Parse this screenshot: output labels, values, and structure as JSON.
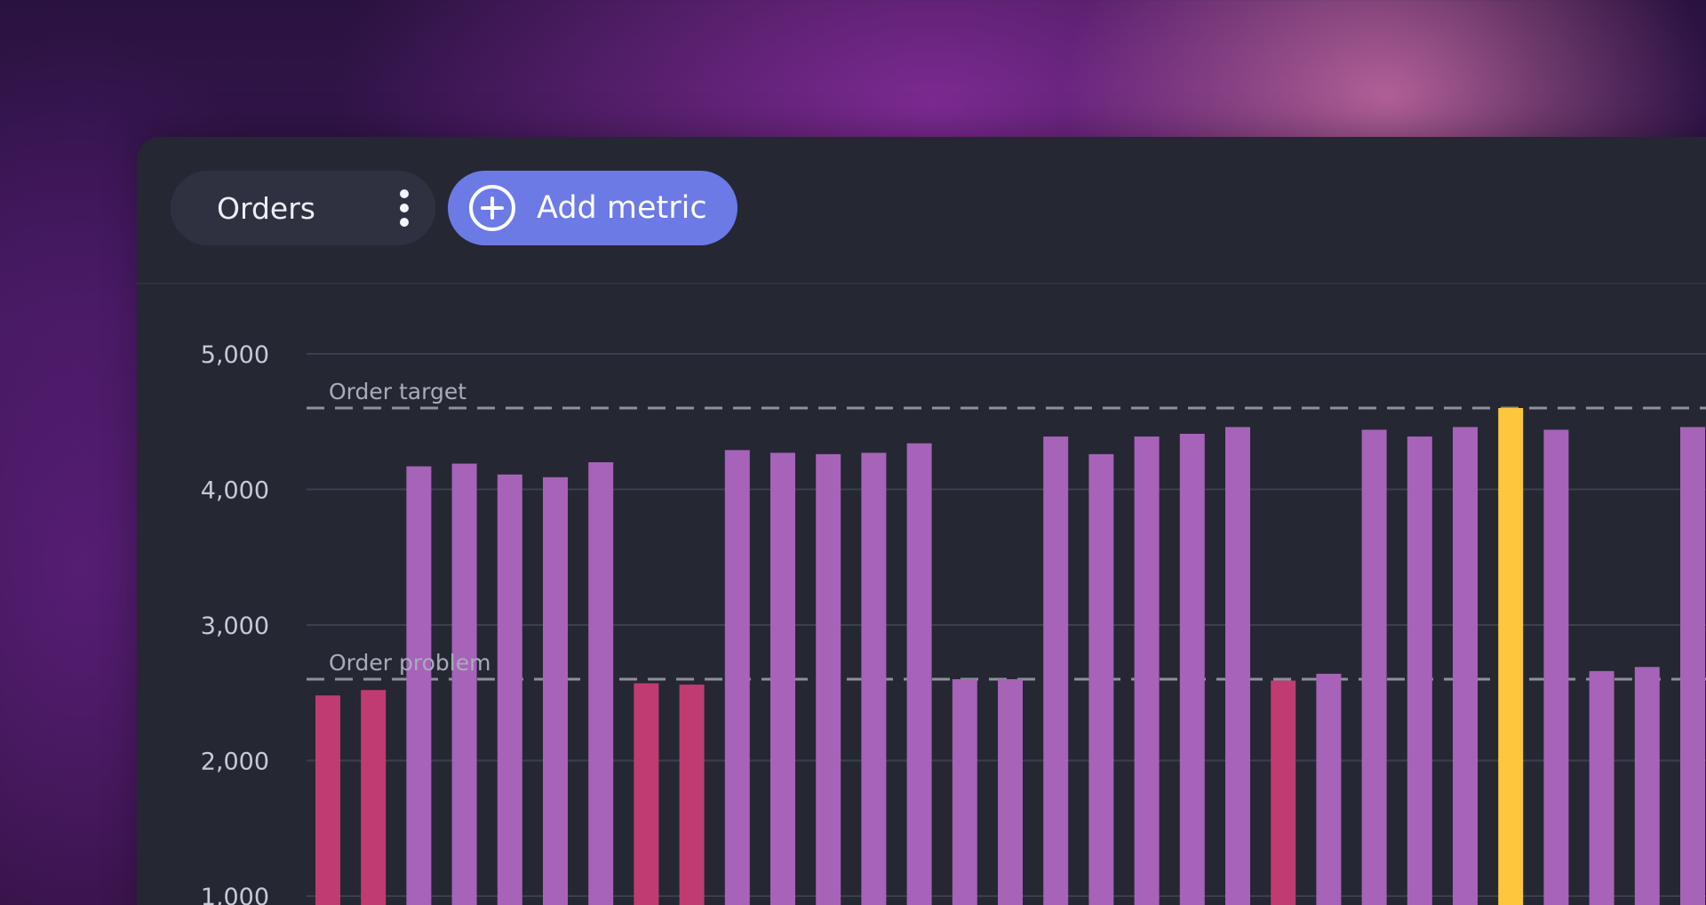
{
  "toolbar": {
    "metric_chip_label": "Orders",
    "add_metric_label": "Add metric",
    "accent_color": "#6c7ae6"
  },
  "icons": {
    "more": "kebab-menu-icon",
    "add": "plus-circle-icon"
  },
  "chart_data": {
    "type": "bar",
    "title": "",
    "xlabel": "",
    "ylabel": "",
    "ylim": [
      1000,
      5000
    ],
    "yticks": [
      1000,
      2000,
      3000,
      4000,
      5000
    ],
    "ytick_labels": [
      "1,000",
      "2,000",
      "3,000",
      "4,000",
      "5,000"
    ],
    "grid": true,
    "values": [
      2480,
      2520,
      4170,
      4190,
      4110,
      4090,
      4200,
      2570,
      2560,
      4290,
      4270,
      4260,
      4270,
      4340,
      2600,
      2600,
      4390,
      4260,
      4390,
      4410,
      4460,
      2590,
      2640,
      4440,
      4390,
      4460,
      4600,
      4440,
      2660,
      2690,
      4460
    ],
    "bar_colors": [
      "#c03c70",
      "#c03c70",
      "#a663b8",
      "#a663b8",
      "#a663b8",
      "#a663b8",
      "#a663b8",
      "#c03c70",
      "#c03c70",
      "#a663b8",
      "#a663b8",
      "#a663b8",
      "#a663b8",
      "#a663b8",
      "#a663b8",
      "#a663b8",
      "#a663b8",
      "#a663b8",
      "#a663b8",
      "#a663b8",
      "#a663b8",
      "#c03c70",
      "#a663b8",
      "#a663b8",
      "#a663b8",
      "#a663b8",
      "#fdc63c",
      "#a663b8",
      "#a663b8",
      "#a663b8",
      "#a663b8"
    ],
    "reference_lines": [
      {
        "label": "Order target",
        "value": 4600
      },
      {
        "label": "Order problem",
        "value": 2600
      }
    ],
    "colors": {
      "normal": "#a663b8",
      "below_problem": "#c03c70",
      "highlight": "#fdc63c"
    }
  }
}
